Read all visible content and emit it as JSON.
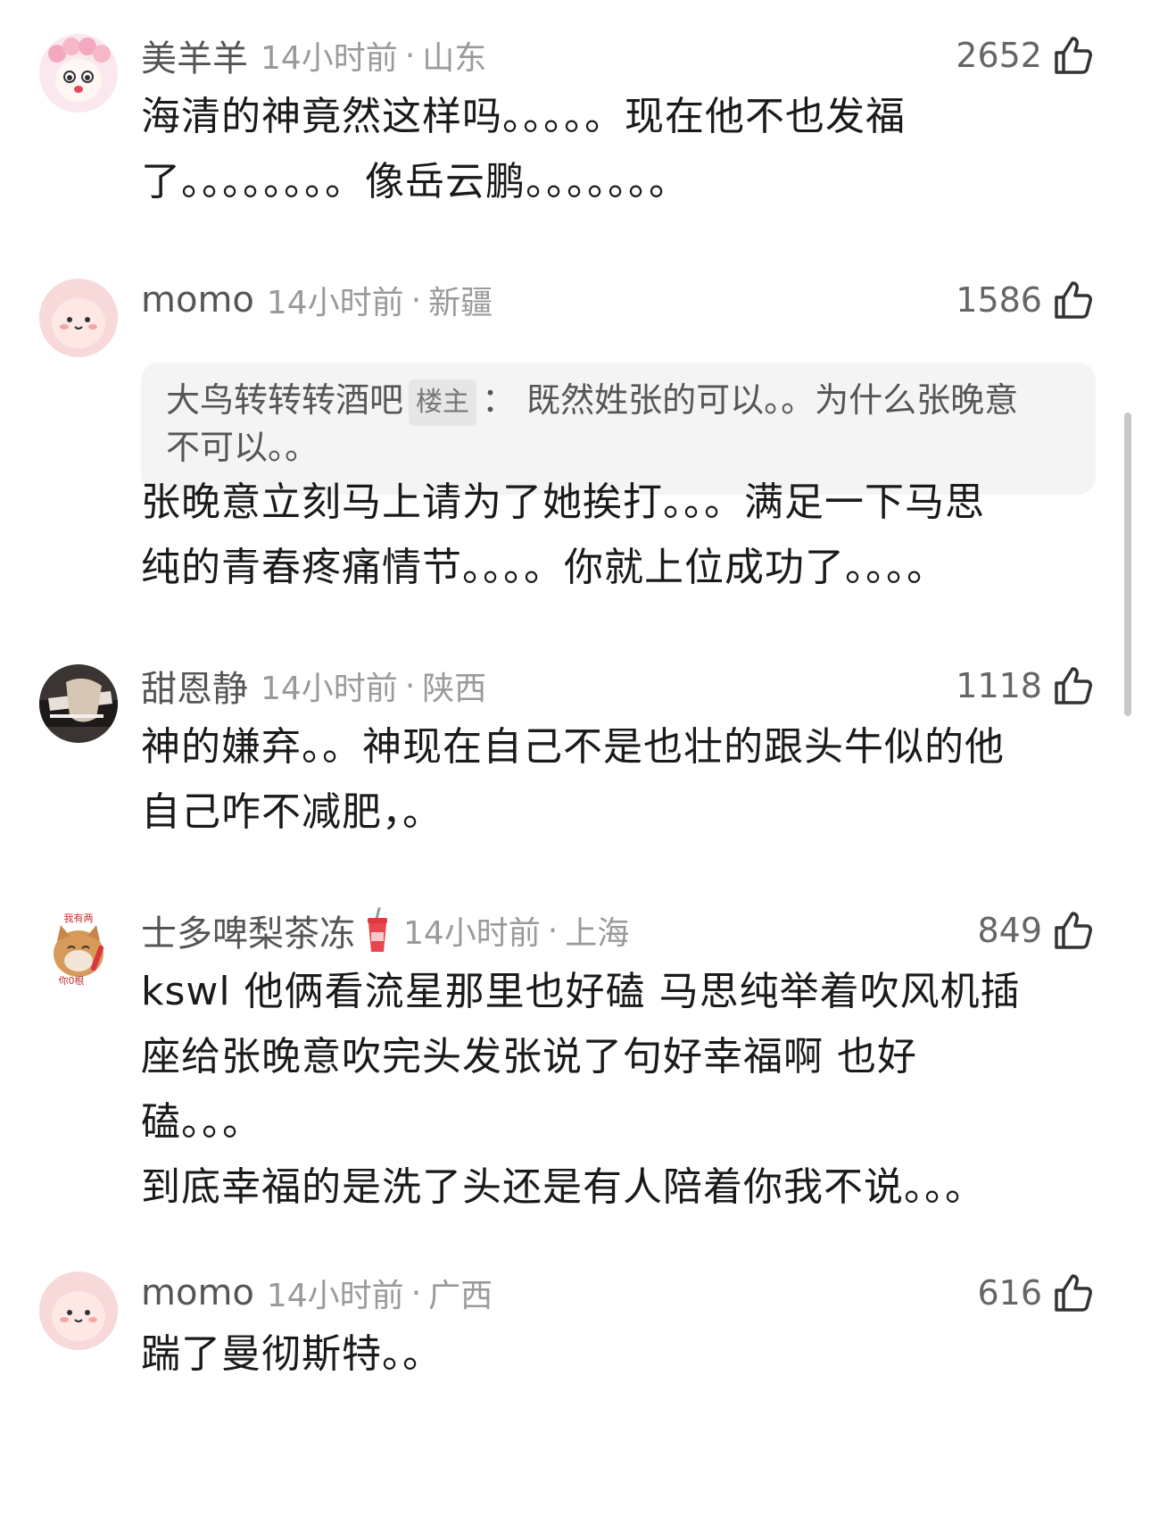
{
  "comments": [
    {
      "username": "美羊羊",
      "time": "14小时前",
      "location": "山东",
      "likes": "2652",
      "avatar_icon": "lamb-avatar-icon",
      "lines": [
        "海清的神竟然这样吗。。。。。现在他不也发福",
        "了。。。。。。。。像岳云鹏。。。。。。。"
      ]
    },
    {
      "username": "momo",
      "time": "14小时前",
      "location": "新疆",
      "likes": "1586",
      "avatar_icon": "pink-blob-avatar-icon",
      "quote": {
        "author": "大鸟转转转酒吧",
        "badge": "楼主",
        "separator": "：",
        "line1": "既然姓张的可以。。为什么张晚意",
        "line2": "不可以。。"
      },
      "lines": [
        "张晚意立刻马上请为了她挨打。。。满足一下马思",
        "纯的青春疼痛情节。。。。你就上位成功了。。。。"
      ]
    },
    {
      "username": "甜恩静",
      "time": "14小时前",
      "location": "陕西",
      "likes": "1118",
      "avatar_icon": "photo-avatar-icon",
      "lines": [
        "神的嫌弃。。神现在自己不是也壮的跟头牛似的他",
        "自己咋不减肥，。"
      ]
    },
    {
      "username": "士多啤梨茶冻",
      "time": "14小时前",
      "location": "上海",
      "likes": "849",
      "avatar_icon": "cat-avatar-icon",
      "avatar_text_top": "我有两",
      "avatar_text_bottom": "你0根",
      "lines": [
        "kswl 他俩看流星那里也好磕 马思纯举着吹风机插",
        "座给张晚意吹完头发张说了句好幸福啊 也好",
        "磕。。。",
        "到底幸福的是洗了头还是有人陪着你我不说。。。"
      ]
    },
    {
      "username": "momo",
      "time": "14小时前",
      "location": "广西",
      "likes": "616",
      "avatar_icon": "pink-blob-avatar-icon",
      "lines": [
        "踹了曼彻斯特。。"
      ]
    }
  ],
  "dot_separator": "·",
  "colors": {
    "text": "#1a1a1a",
    "meta": "#9a9a9a",
    "quote_bg": "#f4f4f4"
  }
}
